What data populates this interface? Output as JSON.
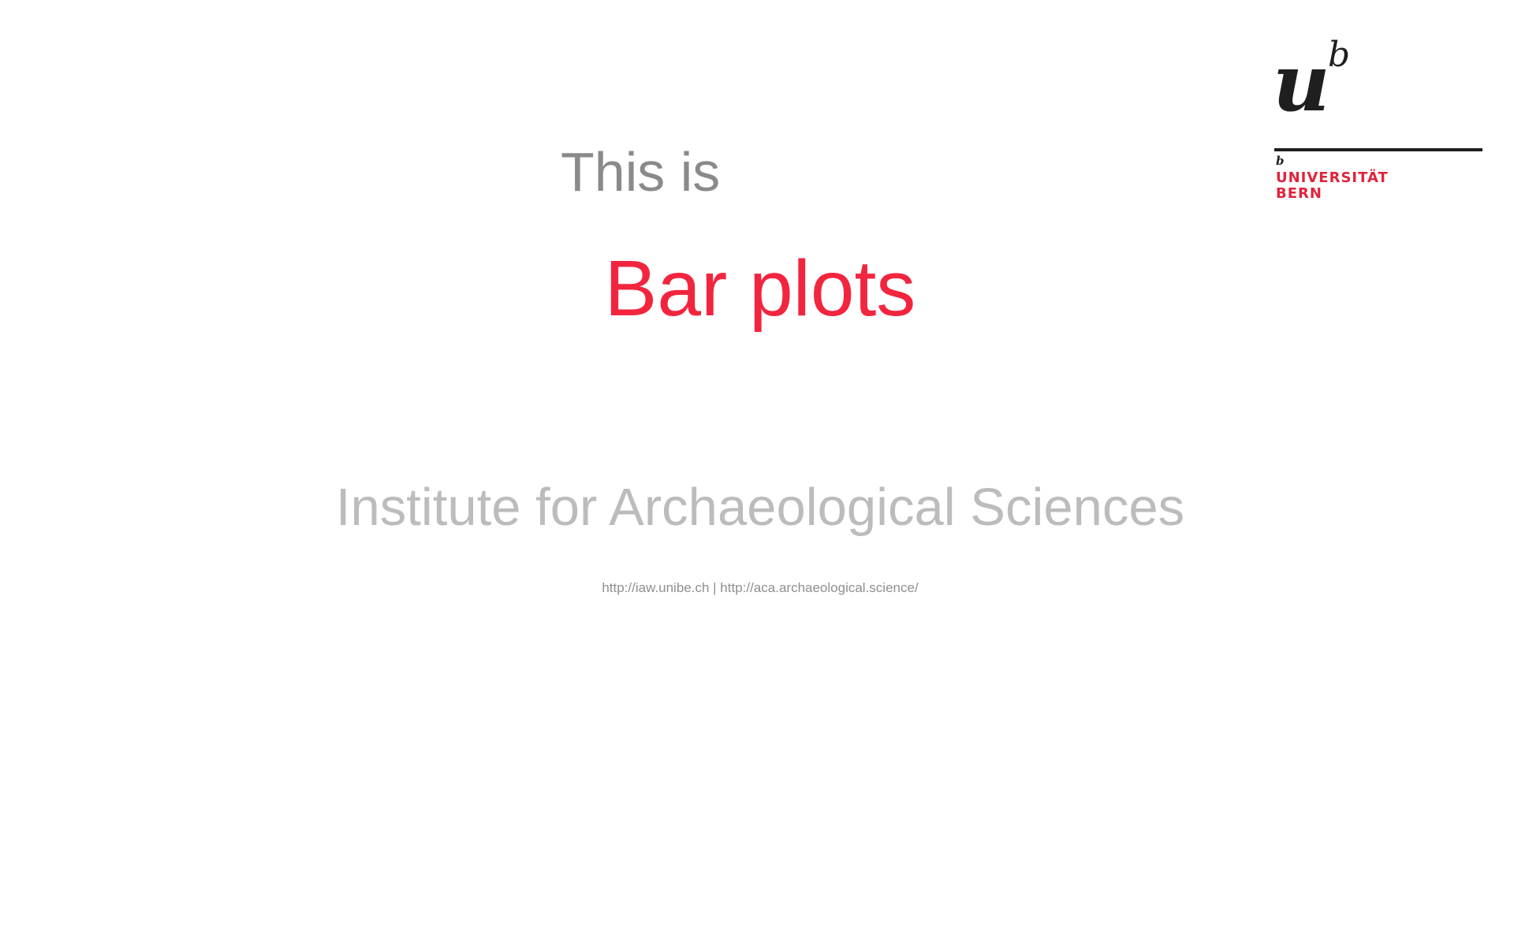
{
  "colors": {
    "accent_red": "#f2253f",
    "intro_gray": "#8a8a8a",
    "institute_gray": "#bcbcbc",
    "link_gray": "#8f8f8f",
    "logo_black": "#1f1f1f",
    "logo_red": "#e0243c"
  },
  "slide": {
    "intro": "This is",
    "title": "Bar plots",
    "institute": "Institute for Archaeological Sciences",
    "links": {
      "first": "http://iaw.unibe.ch",
      "separator": " | ",
      "second": "http://aca.archaeological.science/"
    }
  },
  "logo": {
    "mark_u": "u",
    "mark_b": "b",
    "small_b": "b",
    "line1": "UNIVERSITÄT",
    "line2": "BERN"
  }
}
